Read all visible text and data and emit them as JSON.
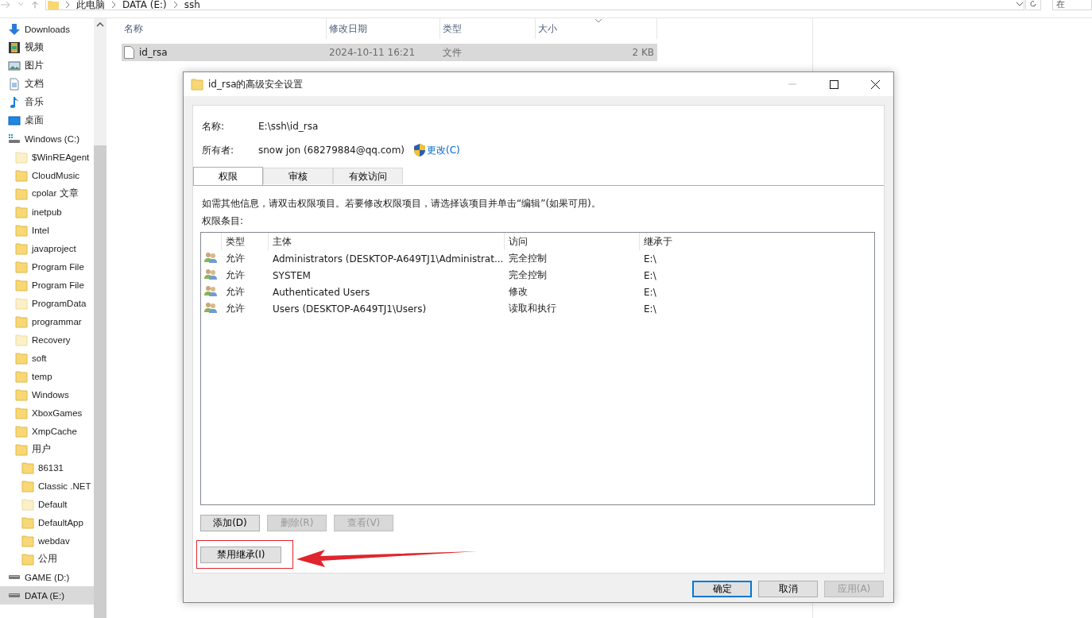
{
  "explorer": {
    "breadcrumbs": [
      "此电脑",
      "DATA (E:)",
      "ssh"
    ],
    "search": {
      "placeholder": "在"
    },
    "sidebar": {
      "items": [
        {
          "label": "Downloads",
          "kind": "download",
          "selected": false
        },
        {
          "label": "视频",
          "kind": "video",
          "selected": false
        },
        {
          "label": "图片",
          "kind": "picture",
          "selected": false
        },
        {
          "label": "文档",
          "kind": "document",
          "selected": false
        },
        {
          "label": "音乐",
          "kind": "music",
          "selected": false
        },
        {
          "label": "桌面",
          "kind": "desktop",
          "selected": false
        },
        {
          "label": "Windows (C:)",
          "kind": "system-drive",
          "selected": false,
          "children": [
            {
              "label": "$WinREAgent",
              "kind": "folder",
              "hidden": true,
              "selected": false
            },
            {
              "label": "CloudMusic",
              "kind": "folder",
              "hidden": false,
              "selected": false
            },
            {
              "label": "cpolar 文章",
              "kind": "folder",
              "hidden": false,
              "selected": false
            },
            {
              "label": "inetpub",
              "kind": "folder",
              "hidden": false,
              "selected": false
            },
            {
              "label": "Intel",
              "kind": "folder",
              "hidden": false,
              "selected": false
            },
            {
              "label": "javaproject",
              "kind": "folder",
              "hidden": false,
              "selected": false
            },
            {
              "label": "Program File",
              "kind": "folder",
              "hidden": false,
              "selected": false
            },
            {
              "label": "Program File",
              "kind": "folder",
              "hidden": false,
              "selected": false
            },
            {
              "label": "ProgramData",
              "kind": "folder",
              "hidden": true,
              "selected": false
            },
            {
              "label": "programmar",
              "kind": "folder",
              "hidden": false,
              "selected": false
            },
            {
              "label": "Recovery",
              "kind": "folder",
              "hidden": true,
              "selected": false
            },
            {
              "label": "soft",
              "kind": "folder",
              "hidden": false,
              "selected": false
            },
            {
              "label": "temp",
              "kind": "folder",
              "hidden": false,
              "selected": false
            },
            {
              "label": "Windows",
              "kind": "folder",
              "hidden": false,
              "selected": false
            },
            {
              "label": "XboxGames",
              "kind": "folder",
              "hidden": false,
              "selected": false
            },
            {
              "label": "XmpCache",
              "kind": "folder",
              "hidden": false,
              "selected": false
            },
            {
              "label": "用户",
              "kind": "folder",
              "hidden": false,
              "selected": false,
              "children": [
                {
                  "label": "86131",
                  "kind": "folder",
                  "hidden": false,
                  "selected": false
                },
                {
                  "label": "Classic .NET",
                  "kind": "folder",
                  "hidden": false,
                  "selected": false
                },
                {
                  "label": "Default",
                  "kind": "folder",
                  "hidden": true,
                  "selected": false
                },
                {
                  "label": "DefaultApp",
                  "kind": "folder",
                  "hidden": false,
                  "selected": false
                },
                {
                  "label": "webdav",
                  "kind": "folder",
                  "hidden": false,
                  "selected": false
                },
                {
                  "label": "公用",
                  "kind": "folder",
                  "hidden": false,
                  "selected": false
                }
              ]
            }
          ]
        },
        {
          "label": "GAME (D:)",
          "kind": "drive",
          "selected": false
        },
        {
          "label": "DATA (E:)",
          "kind": "drive",
          "selected": true
        }
      ]
    },
    "file_list": {
      "columns": [
        "名称",
        "修改日期",
        "类型",
        "大小"
      ],
      "rows": [
        {
          "name": "id_rsa",
          "modified": "2024-10-11 16:21",
          "type": "文件",
          "size": "2 KB",
          "selected": true
        }
      ]
    }
  },
  "dialog": {
    "title": "id_rsa的高级安全设置",
    "name_label": "名称:",
    "name_value": "E:\\ssh\\id_rsa",
    "owner_label": "所有者:",
    "owner_value": "snow jon (68279884@qq.com)",
    "change_link": "更改(C)",
    "tabs": [
      {
        "label": "权限",
        "selected": true
      },
      {
        "label": "审核",
        "selected": false
      },
      {
        "label": "有效访问",
        "selected": false
      }
    ],
    "description": "如需其他信息，请双击权限项目。若要修改权限项目，请选择该项目并单击“编辑”(如果可用)。",
    "entries_label": "权限条目:",
    "table": {
      "columns": [
        "类型",
        "主体",
        "访问",
        "继承于"
      ],
      "rows": [
        {
          "type": "允许",
          "principal": "Administrators (DESKTOP-A649TJ1\\Administrat...",
          "access": "完全控制",
          "inherited_from": "E:\\"
        },
        {
          "type": "允许",
          "principal": "SYSTEM",
          "access": "完全控制",
          "inherited_from": "E:\\"
        },
        {
          "type": "允许",
          "principal": "Authenticated Users",
          "access": "修改",
          "inherited_from": "E:\\"
        },
        {
          "type": "允许",
          "principal": "Users (DESKTOP-A649TJ1\\Users)",
          "access": "读取和执行",
          "inherited_from": "E:\\"
        }
      ]
    },
    "entry_buttons": [
      {
        "label": "添加(D)",
        "disabled": false
      },
      {
        "label": "删除(R)",
        "disabled": true
      },
      {
        "label": "查看(V)",
        "disabled": true
      }
    ],
    "inherit_button": {
      "label": "禁用继承(I)",
      "highlighted": true
    },
    "footer_buttons": [
      {
        "label": "确定",
        "default": true,
        "disabled": false
      },
      {
        "label": "取消",
        "default": false,
        "disabled": false
      },
      {
        "label": "应用(A)",
        "default": false,
        "disabled": true
      }
    ]
  }
}
